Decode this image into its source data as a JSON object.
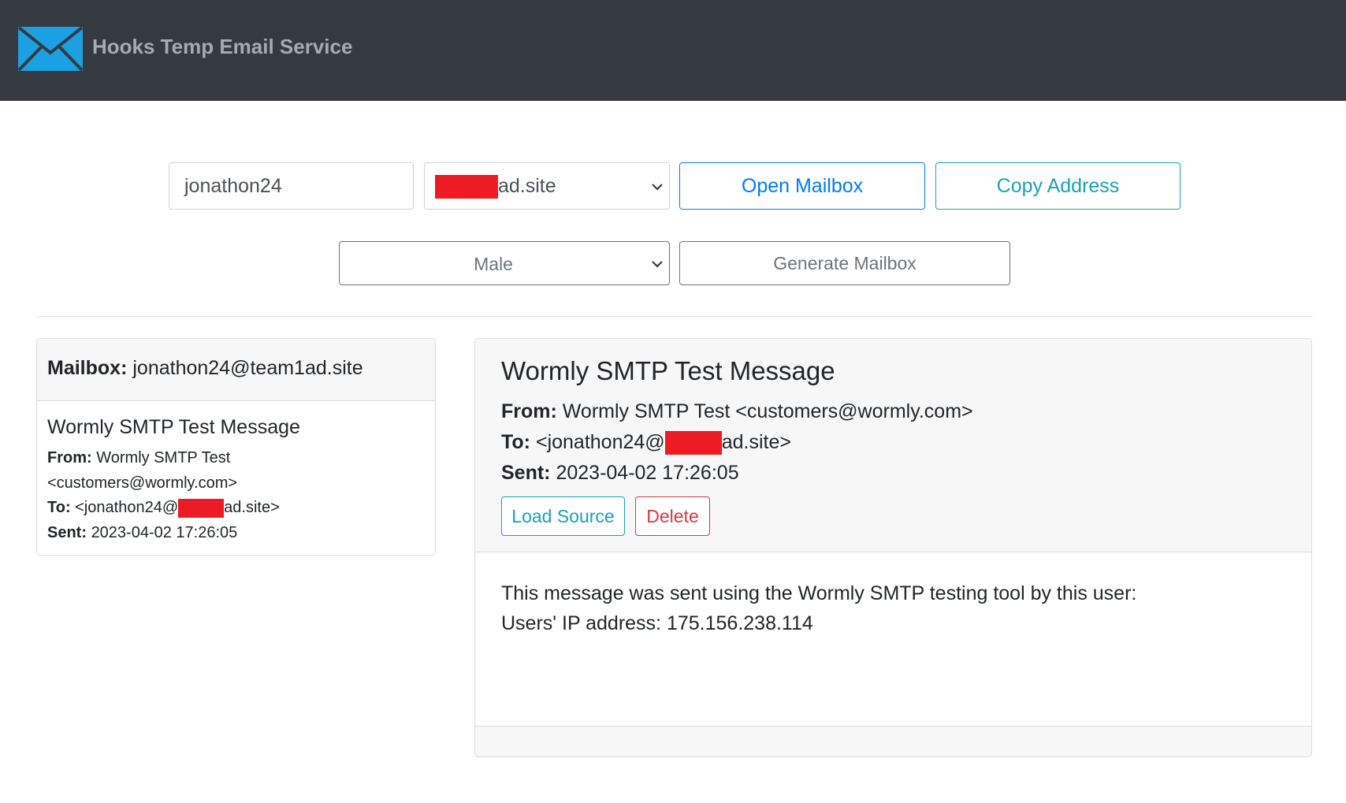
{
  "header": {
    "title": "Hooks Temp Email Service",
    "logo_icon": "envelope-icon"
  },
  "form": {
    "username_value": "jonathon24",
    "domain_selected_suffix": "ad.site",
    "open_mailbox_label": "Open Mailbox",
    "copy_address_label": "Copy Address",
    "gender_selected": "Male",
    "generate_label": "Generate Mailbox"
  },
  "mailbox": {
    "label": "Mailbox:",
    "address": "jonathon24@team1ad.site",
    "messages": [
      {
        "subject": "Wormly SMTP Test Message",
        "from_label": "From:",
        "from_line1": "Wormly SMTP Test",
        "from_line2": "<customers@wormly.com>",
        "to_label": "To:",
        "to_prefix": "<jonathon24@",
        "to_suffix": "ad.site>",
        "sent_label": "Sent:",
        "sent": "2023-04-02 17:26:05"
      }
    ]
  },
  "message": {
    "subject": "Wormly SMTP Test Message",
    "from_label": "From:",
    "from": "Wormly SMTP Test <customers@wormly.com>",
    "to_label": "To:",
    "to_prefix": "<jonathon24@",
    "to_suffix": "ad.site>",
    "sent_label": "Sent:",
    "sent": "2023-04-02 17:26:05",
    "load_source_label": "Load Source",
    "delete_label": "Delete",
    "body_line1": "This message was sent using the Wormly SMTP testing tool by this user:",
    "body_line2": "Users' IP address: 175.156.238.114"
  },
  "colors": {
    "navbar": "#343a40",
    "primary": "#007bff",
    "info": "#17a2b8",
    "danger": "#dc3545",
    "secondary": "#6c757d",
    "redaction": "#ed1c24"
  }
}
